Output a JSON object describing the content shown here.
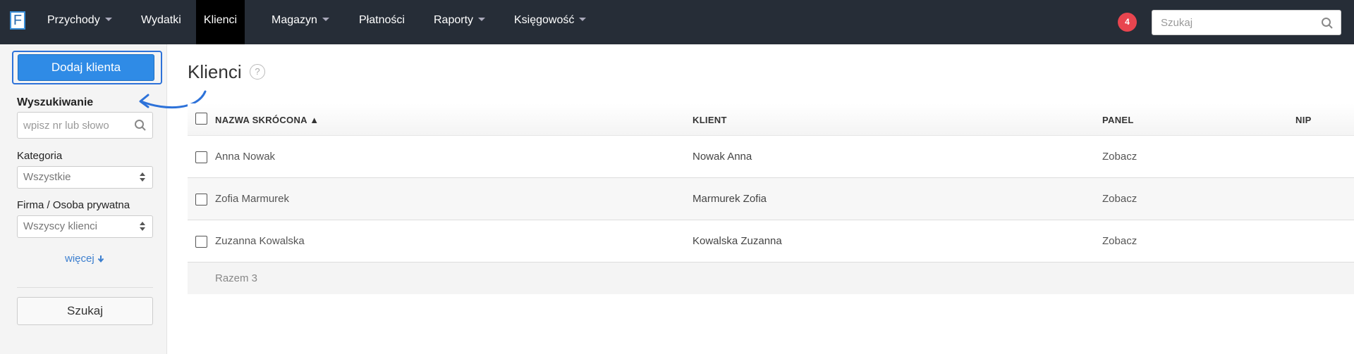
{
  "nav": {
    "logo": "F",
    "items": [
      {
        "label": "Przychody",
        "caret": true
      },
      {
        "label": "Wydatki",
        "caret": false
      },
      {
        "label": "Klienci",
        "caret": false,
        "active": true
      },
      {
        "label": "Magazyn",
        "caret": true
      },
      {
        "label": "Płatności",
        "caret": false
      },
      {
        "label": "Raporty",
        "caret": true
      },
      {
        "label": "Księgowość",
        "caret": true
      }
    ],
    "notifications": "4",
    "search_placeholder": "Szukaj"
  },
  "sidebar": {
    "add_button": "Dodaj klienta",
    "search_label": "Wyszukiwanie",
    "search_placeholder": "wpisz nr lub słowo",
    "category_label": "Kategoria",
    "category_value": "Wszystkie",
    "type_label": "Firma / Osoba prywatna",
    "type_value": "Wszyscy klienci",
    "more_link": "więcej",
    "search_button": "Szukaj"
  },
  "main": {
    "title": "Klienci",
    "help": "?",
    "columns": [
      "NAZWA SKRÓCONA ▲",
      "KLIENT",
      "PANEL",
      "NIP"
    ],
    "rows": [
      {
        "short_name": "Anna Nowak",
        "client": "Nowak Anna",
        "panel": "Zobacz",
        "nip": ""
      },
      {
        "short_name": "Zofia Marmurek",
        "client": "Marmurek Zofia",
        "panel": "Zobacz",
        "nip": ""
      },
      {
        "short_name": "Zuzanna Kowalska",
        "client": "Kowalska Zuzanna",
        "panel": "Zobacz",
        "nip": ""
      }
    ],
    "total": "Razem 3"
  },
  "colors": {
    "topbar": "#262d37",
    "primary": "#2f8be6",
    "highlight_outline": "#2d72d9",
    "badge": "#e8454f"
  }
}
